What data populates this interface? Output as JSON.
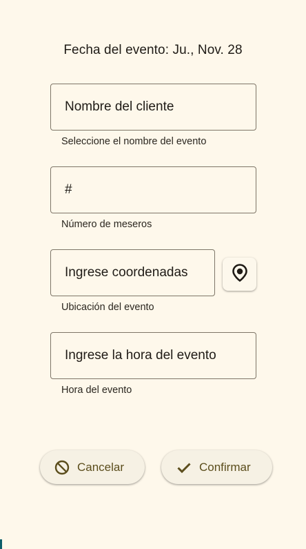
{
  "header": {
    "date_label": "Fecha del evento: Ju., Nov. 28"
  },
  "form": {
    "client": {
      "placeholder": "Nombre del cliente",
      "helper": "Seleccione el nombre del evento"
    },
    "waiters": {
      "placeholder": "#",
      "helper": "Número de meseros"
    },
    "location": {
      "placeholder": "Ingrese coordenadas",
      "helper": "Ubicación del evento",
      "button_icon": "location-target-icon"
    },
    "time": {
      "placeholder": "Ingrese la hora del evento",
      "helper": "Hora del evento"
    }
  },
  "actions": {
    "cancel_label": "Cancelar",
    "cancel_icon": "block-icon",
    "confirm_label": "Confirmar",
    "confirm_icon": "check-icon"
  },
  "colors": {
    "background": "#fef8eb",
    "outline": "#7d7567",
    "button_text": "#5b4d1c"
  }
}
